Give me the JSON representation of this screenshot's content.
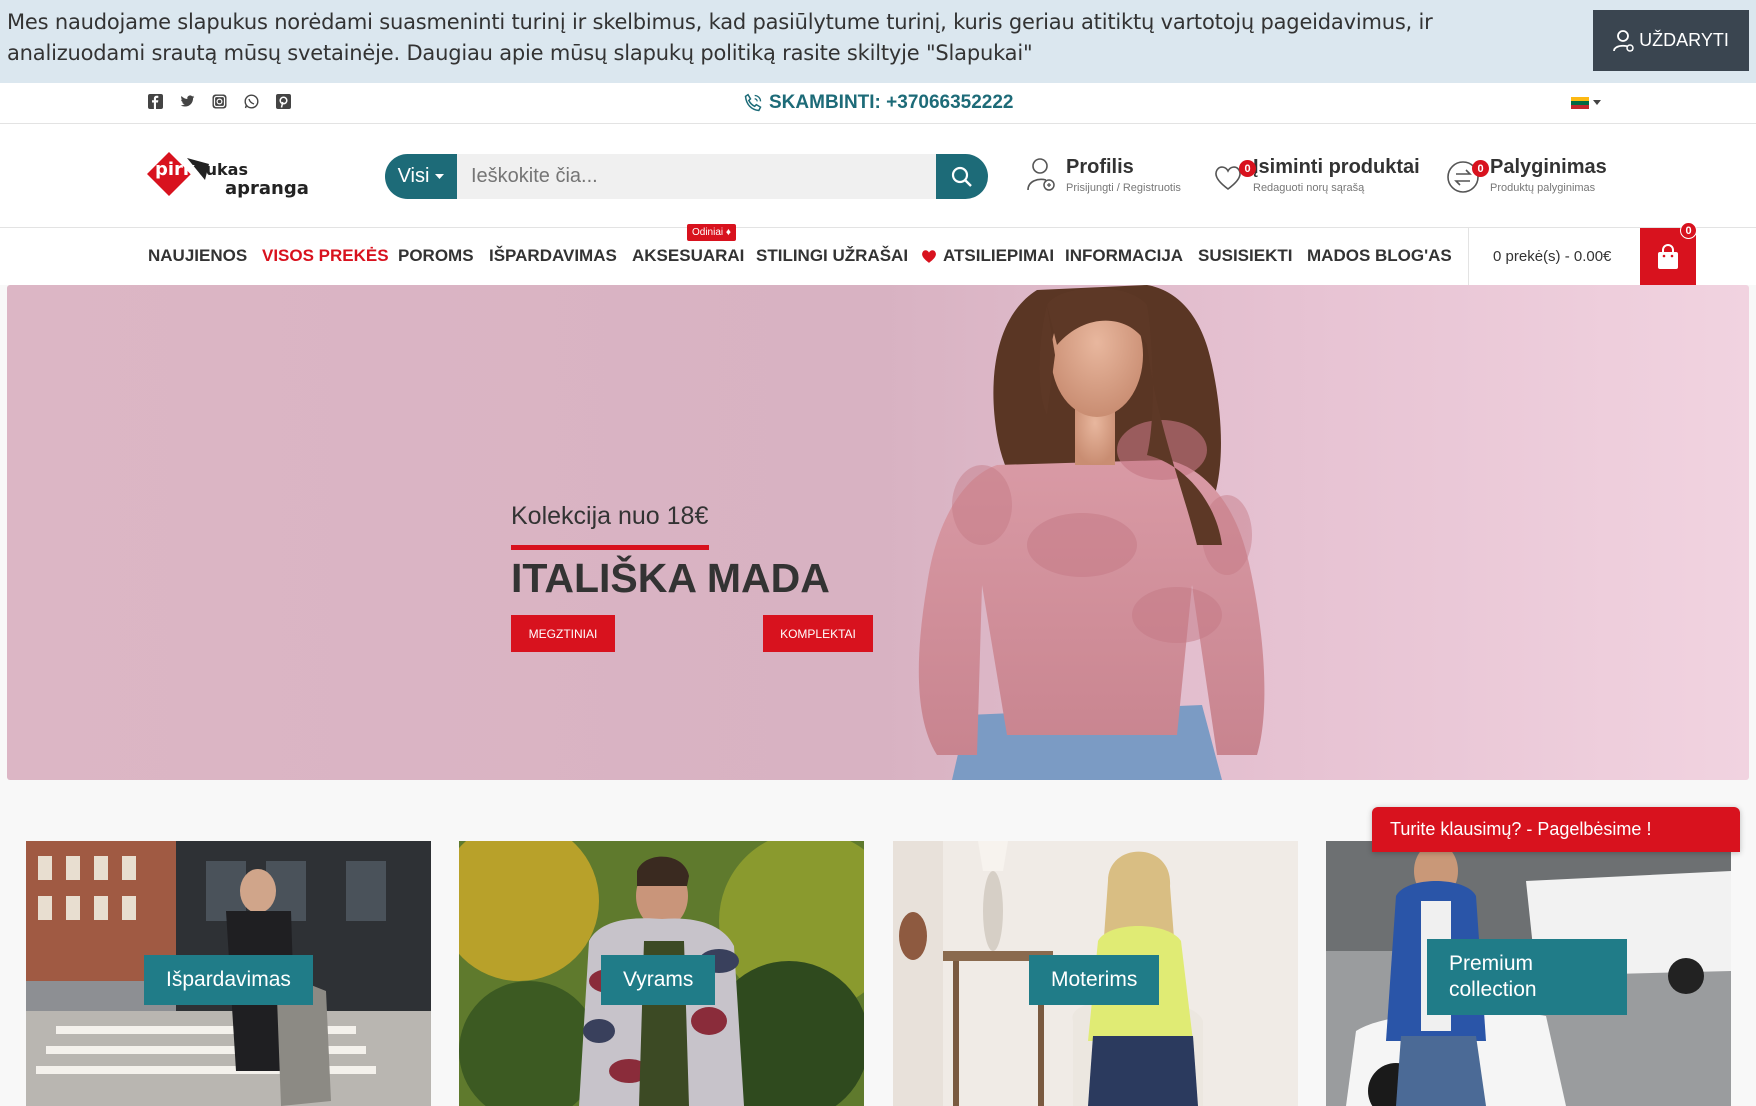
{
  "cookie": {
    "text": "Mes naudojame slapukus norėdami suasmeninti turinį ir skelbimus, kad pasiūlytume turinį, kuris geriau atitiktų vartotojų pageidavimus, ir analizuodami srautą mūsų svetainėje. Daugiau apie mūsų slapukų politiką rasite skiltyje \"Slapukai\"",
    "close_label": "UŽDARYTI"
  },
  "topbar": {
    "social_icons": [
      "facebook-icon",
      "twitter-icon",
      "instagram-icon",
      "whatsapp-icon",
      "pinterest-icon"
    ],
    "phone": "SKAMBINTI: +37066352222"
  },
  "header": {
    "logo": {
      "part1": "pirk",
      "part2": "tukas",
      "part3": "apranga"
    },
    "search": {
      "category": "Visi",
      "placeholder": "Ieškokite čia..."
    },
    "profile": {
      "title": "Profilis",
      "subtitle": "Prisijungti / Registruotis"
    },
    "wishlist": {
      "title": "Įsiminti produktai",
      "subtitle": "Redaguoti norų sąrašą",
      "count": "0"
    },
    "compare": {
      "title": "Palyginimas",
      "subtitle": "Produktų palyginimas",
      "count": "0"
    }
  },
  "nav": {
    "items": [
      "NAUJIENOS",
      "VISOS PREKĖS",
      "POROMS",
      "IŠPARDAVIMAS",
      "AKSESUARAI",
      "STILINGI UŽRAŠAI",
      "ATSILIEPIMAI",
      "INFORMACIJA",
      "SUSISIEKTI",
      "MADOS BLOG'AS"
    ],
    "tag": "Odiniai ♦",
    "cart_text": "0 prekė(s) - 0.00€",
    "cart_count": "0"
  },
  "hero": {
    "subtitle": "Kolekcija nuo 18€",
    "title": "ITALIŠKA MADA",
    "buttons": [
      "MEGZTINIAI",
      "KOMPLEKTAI"
    ]
  },
  "categories": [
    "Išpardavimas",
    "Vyrams",
    "Moterims",
    "Premium collection"
  ],
  "chat": {
    "label": "Turite klausimų? - Pagelbėsime !"
  },
  "colors": {
    "accent": "#1d6b78",
    "red": "#d8121e",
    "card_label": "#207c88"
  }
}
